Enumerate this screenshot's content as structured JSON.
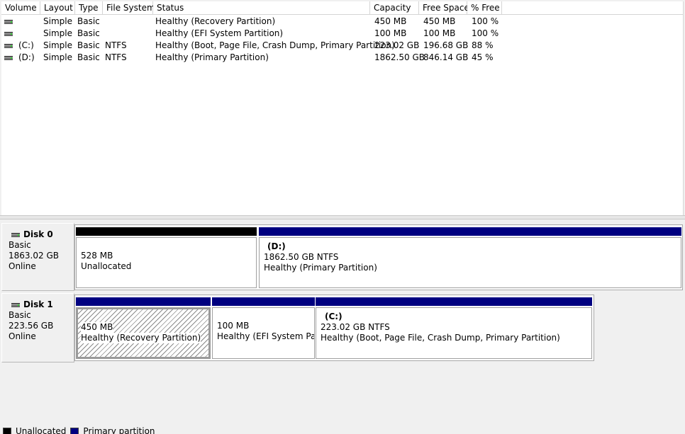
{
  "columns": [
    "Volume",
    "Layout",
    "Type",
    "File System",
    "Status",
    "Capacity",
    "Free Space",
    "% Free"
  ],
  "volumes": [
    {
      "volume": "",
      "layout": "Simple",
      "type": "Basic",
      "fs": "",
      "status": "Healthy (Recovery Partition)",
      "capacity": "450 MB",
      "free": "450 MB",
      "pct": "100 %"
    },
    {
      "volume": "",
      "layout": "Simple",
      "type": "Basic",
      "fs": "",
      "status": "Healthy (EFI System Partition)",
      "capacity": "100 MB",
      "free": "100 MB",
      "pct": "100 %"
    },
    {
      "volume": "(C:)",
      "layout": "Simple",
      "type": "Basic",
      "fs": "NTFS",
      "status": "Healthy (Boot, Page File, Crash Dump, Primary Partition)",
      "capacity": "223.02 GB",
      "free": "196.68 GB",
      "pct": "88 %"
    },
    {
      "volume": "(D:)",
      "layout": "Simple",
      "type": "Basic",
      "fs": "NTFS",
      "status": "Healthy (Primary Partition)",
      "capacity": "1862.50 GB",
      "free": "846.14 GB",
      "pct": "45 %"
    }
  ],
  "disks": [
    {
      "name": "Disk 0",
      "kind": "Basic",
      "size": "1863.02 GB",
      "state": "Online",
      "partitions": [
        {
          "name": "",
          "size": "528 MB",
          "detail": "Unallocated",
          "bar_color": "#000000"
        },
        {
          "name": "(D:)",
          "size": "1862.50 GB NTFS",
          "detail": "Healthy (Primary Partition)",
          "bar_color": "#000080"
        }
      ]
    },
    {
      "name": "Disk 1",
      "kind": "Basic",
      "size": "223.56 GB",
      "state": "Online",
      "partitions": [
        {
          "name": "",
          "size": "450 MB",
          "detail": "Healthy (Recovery Partition)",
          "bar_color": "#000080"
        },
        {
          "name": "",
          "size": "100 MB",
          "detail": "Healthy (EFI System Parti",
          "bar_color": "#000080"
        },
        {
          "name": "(C:)",
          "size": "223.02 GB NTFS",
          "detail": "Healthy (Boot, Page File, Crash Dump, Primary Partition)",
          "bar_color": "#000080"
        }
      ]
    }
  ],
  "legend": [
    {
      "label": "Unallocated",
      "color": "#000000"
    },
    {
      "label": "Primary partition",
      "color": "#000080"
    }
  ]
}
